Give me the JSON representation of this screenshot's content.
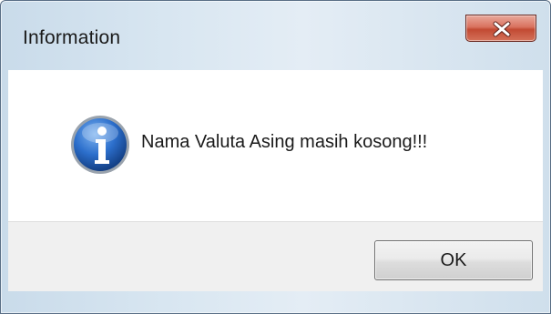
{
  "window": {
    "title": "Information"
  },
  "dialog": {
    "icon": "info-icon",
    "message": "Nama Valuta Asing masih kosong!!!",
    "ok_label": "OK"
  },
  "colors": {
    "title_bar": "#d8e6f1",
    "close_button": "#c24a33",
    "info_icon": "#1f5fb5",
    "footer": "#f0f0f0"
  }
}
